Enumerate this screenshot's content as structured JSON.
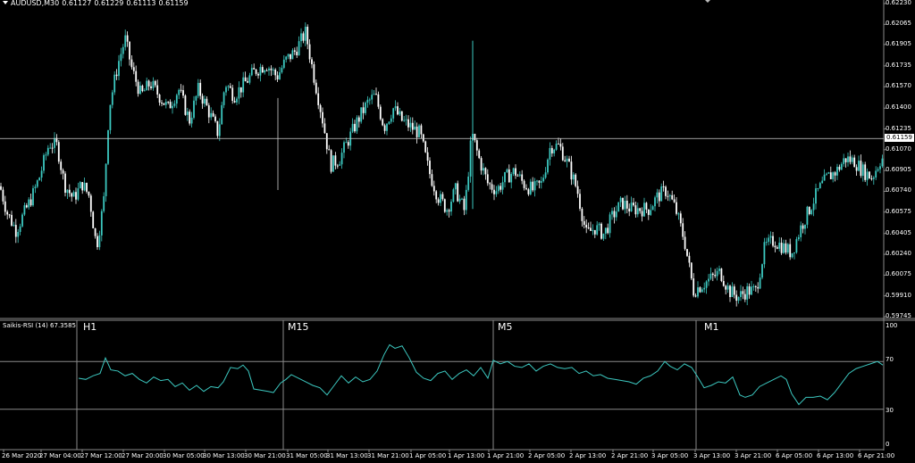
{
  "header": {
    "symbol": "AUDUSD,M30",
    "open": "0.61127",
    "high": "0.61229",
    "low": "0.61113",
    "close": "0.61159"
  },
  "indicator": {
    "label": "Saikis-RSI (14) 67.3585",
    "levels": [
      "100",
      "70",
      "30",
      "0"
    ],
    "timeframes": [
      "H1",
      "M15",
      "M5",
      "M1"
    ]
  },
  "price_axis": [
    "0.62230",
    "0.62065",
    "0.61905",
    "0.61735",
    "0.61570",
    "0.61400",
    "0.61235",
    "0.61070",
    "0.60905",
    "0.60740",
    "0.60575",
    "0.60405",
    "0.60240",
    "0.60075",
    "0.59910",
    "0.59745"
  ],
  "current_price": "0.61159",
  "time_axis": [
    "26 Mar 2020",
    "27 Mar 04:00",
    "27 Mar 12:00",
    "27 Mar 20:00",
    "30 Mar 05:00",
    "30 Mar 13:00",
    "30 Mar 21:00",
    "31 Mar 05:00",
    "31 Mar 13:00",
    "31 Mar 21:00",
    "1 Apr 05:00",
    "1 Apr 13:00",
    "1 Apr 21:00",
    "2 Apr 05:00",
    "2 Apr 13:00",
    "2 Apr 21:00",
    "3 Apr 05:00",
    "3 Apr 13:00",
    "3 Apr 21:00",
    "6 Apr 05:00",
    "6 Apr 13:00",
    "6 Apr 21:00"
  ],
  "colors": {
    "bull": "#3cc8c0",
    "bear": "#ffffff",
    "grid": "#8a8a8a",
    "rsi_line": "#3cc8c0"
  },
  "chart_data": {
    "type": "candlestick",
    "ylim": [
      0.59745,
      0.6223
    ],
    "price_points": [
      [
        0,
        0.6078
      ],
      [
        8,
        0.6057
      ],
      [
        18,
        0.6043
      ],
      [
        26,
        0.6055
      ],
      [
        36,
        0.607
      ],
      [
        44,
        0.6085
      ],
      [
        55,
        0.6112
      ],
      [
        64,
        0.611
      ],
      [
        72,
        0.608
      ],
      [
        82,
        0.6068
      ],
      [
        92,
        0.608
      ],
      [
        100,
        0.607
      ],
      [
        108,
        0.603
      ],
      [
        116,
        0.6065
      ],
      [
        122,
        0.614
      ],
      [
        132,
        0.6175
      ],
      [
        140,
        0.6195
      ],
      [
        148,
        0.617
      ],
      [
        158,
        0.615
      ],
      [
        168,
        0.616
      ],
      [
        178,
        0.615
      ],
      [
        188,
        0.614
      ],
      [
        200,
        0.6155
      ],
      [
        212,
        0.613
      ],
      [
        222,
        0.6155
      ],
      [
        232,
        0.614
      ],
      [
        244,
        0.612
      ],
      [
        252,
        0.616
      ],
      [
        262,
        0.615
      ],
      [
        274,
        0.616
      ],
      [
        286,
        0.617
      ],
      [
        298,
        0.6175
      ],
      [
        310,
        0.6165
      ],
      [
        320,
        0.6178
      ],
      [
        330,
        0.6185
      ],
      [
        342,
        0.62
      ],
      [
        350,
        0.617
      ],
      [
        360,
        0.6135
      ],
      [
        370,
        0.6095
      ],
      [
        380,
        0.61
      ],
      [
        390,
        0.6115
      ],
      [
        400,
        0.613
      ],
      [
        412,
        0.6145
      ],
      [
        420,
        0.615
      ],
      [
        430,
        0.6125
      ],
      [
        440,
        0.614
      ],
      [
        450,
        0.613
      ],
      [
        460,
        0.6125
      ],
      [
        470,
        0.612
      ],
      [
        480,
        0.609
      ],
      [
        490,
        0.607
      ],
      [
        500,
        0.606
      ],
      [
        510,
        0.6075
      ],
      [
        520,
        0.6058
      ],
      [
        528,
        0.612
      ],
      [
        536,
        0.61
      ],
      [
        546,
        0.608
      ],
      [
        556,
        0.6075
      ],
      [
        566,
        0.6085
      ],
      [
        576,
        0.609
      ],
      [
        586,
        0.608
      ],
      [
        596,
        0.6075
      ],
      [
        606,
        0.608
      ],
      [
        616,
        0.611
      ],
      [
        626,
        0.611
      ],
      [
        636,
        0.6095
      ],
      [
        646,
        0.6075
      ],
      [
        656,
        0.604
      ],
      [
        666,
        0.6045
      ],
      [
        676,
        0.604
      ],
      [
        686,
        0.6055
      ],
      [
        696,
        0.6065
      ],
      [
        706,
        0.606
      ],
      [
        716,
        0.606
      ],
      [
        726,
        0.606
      ],
      [
        736,
        0.607
      ],
      [
        746,
        0.6075
      ],
      [
        756,
        0.606
      ],
      [
        766,
        0.6035
      ],
      [
        776,
        0.5995
      ],
      [
        786,
        0.6
      ],
      [
        796,
        0.6005
      ],
      [
        806,
        0.601
      ],
      [
        816,
        0.5995
      ],
      [
        826,
        0.599
      ],
      [
        836,
        0.5995
      ],
      [
        846,
        0.5995
      ],
      [
        856,
        0.603
      ],
      [
        866,
        0.6035
      ],
      [
        876,
        0.603
      ],
      [
        886,
        0.6025
      ],
      [
        896,
        0.6045
      ],
      [
        906,
        0.606
      ],
      [
        916,
        0.6075
      ],
      [
        926,
        0.6085
      ],
      [
        936,
        0.609
      ],
      [
        946,
        0.61
      ],
      [
        956,
        0.6098
      ],
      [
        966,
        0.609
      ],
      [
        976,
        0.6085
      ],
      [
        986,
        0.61
      ]
    ],
    "rsi_points": [
      [
        88,
        56
      ],
      [
        96,
        55
      ],
      [
        104,
        58
      ],
      [
        112,
        60
      ],
      [
        118,
        73
      ],
      [
        124,
        63
      ],
      [
        132,
        62
      ],
      [
        140,
        58
      ],
      [
        148,
        60
      ],
      [
        156,
        55
      ],
      [
        164,
        52
      ],
      [
        172,
        57
      ],
      [
        180,
        54
      ],
      [
        188,
        55
      ],
      [
        196,
        49
      ],
      [
        204,
        52
      ],
      [
        212,
        46
      ],
      [
        220,
        50
      ],
      [
        228,
        45
      ],
      [
        236,
        49
      ],
      [
        244,
        48
      ],
      [
        250,
        53
      ],
      [
        258,
        65
      ],
      [
        266,
        64
      ],
      [
        272,
        67
      ],
      [
        278,
        62
      ],
      [
        284,
        47
      ],
      [
        292,
        46
      ],
      [
        300,
        45
      ],
      [
        306,
        44
      ],
      [
        314,
        52
      ],
      [
        320,
        55
      ],
      [
        326,
        59
      ],
      [
        334,
        56
      ],
      [
        342,
        53
      ],
      [
        350,
        50
      ],
      [
        358,
        48
      ],
      [
        366,
        42
      ],
      [
        374,
        50
      ],
      [
        382,
        58
      ],
      [
        390,
        52
      ],
      [
        398,
        57
      ],
      [
        406,
        53
      ],
      [
        414,
        55
      ],
      [
        422,
        62
      ],
      [
        430,
        76
      ],
      [
        436,
        84
      ],
      [
        442,
        81
      ],
      [
        450,
        83
      ],
      [
        458,
        73
      ],
      [
        466,
        61
      ],
      [
        474,
        56
      ],
      [
        482,
        54
      ],
      [
        490,
        60
      ],
      [
        498,
        62
      ],
      [
        506,
        55
      ],
      [
        514,
        60
      ],
      [
        522,
        63
      ],
      [
        530,
        58
      ],
      [
        538,
        65
      ],
      [
        546,
        56
      ],
      [
        552,
        71
      ],
      [
        560,
        68
      ],
      [
        568,
        70
      ],
      [
        576,
        66
      ],
      [
        584,
        65
      ],
      [
        592,
        68
      ],
      [
        600,
        62
      ],
      [
        608,
        66
      ],
      [
        616,
        68
      ],
      [
        624,
        65
      ],
      [
        632,
        64
      ],
      [
        640,
        65
      ],
      [
        648,
        60
      ],
      [
        656,
        62
      ],
      [
        664,
        58
      ],
      [
        672,
        59
      ],
      [
        680,
        56
      ],
      [
        688,
        55
      ],
      [
        696,
        54
      ],
      [
        704,
        53
      ],
      [
        712,
        51
      ],
      [
        720,
        56
      ],
      [
        728,
        58
      ],
      [
        736,
        62
      ],
      [
        744,
        70
      ],
      [
        750,
        66
      ],
      [
        758,
        63
      ],
      [
        766,
        68
      ],
      [
        774,
        65
      ],
      [
        780,
        58
      ],
      [
        788,
        48
      ],
      [
        796,
        50
      ],
      [
        804,
        53
      ],
      [
        812,
        52
      ],
      [
        820,
        57
      ],
      [
        828,
        42
      ],
      [
        834,
        40
      ],
      [
        842,
        42
      ],
      [
        850,
        49
      ],
      [
        858,
        52
      ],
      [
        866,
        55
      ],
      [
        874,
        58
      ],
      [
        880,
        55
      ],
      [
        886,
        43
      ],
      [
        894,
        34
      ],
      [
        902,
        40
      ],
      [
        910,
        40
      ],
      [
        918,
        41
      ],
      [
        926,
        38
      ],
      [
        934,
        44
      ],
      [
        942,
        52
      ],
      [
        950,
        60
      ],
      [
        958,
        64
      ],
      [
        966,
        66
      ],
      [
        974,
        68
      ],
      [
        982,
        70
      ],
      [
        988,
        67
      ]
    ]
  }
}
